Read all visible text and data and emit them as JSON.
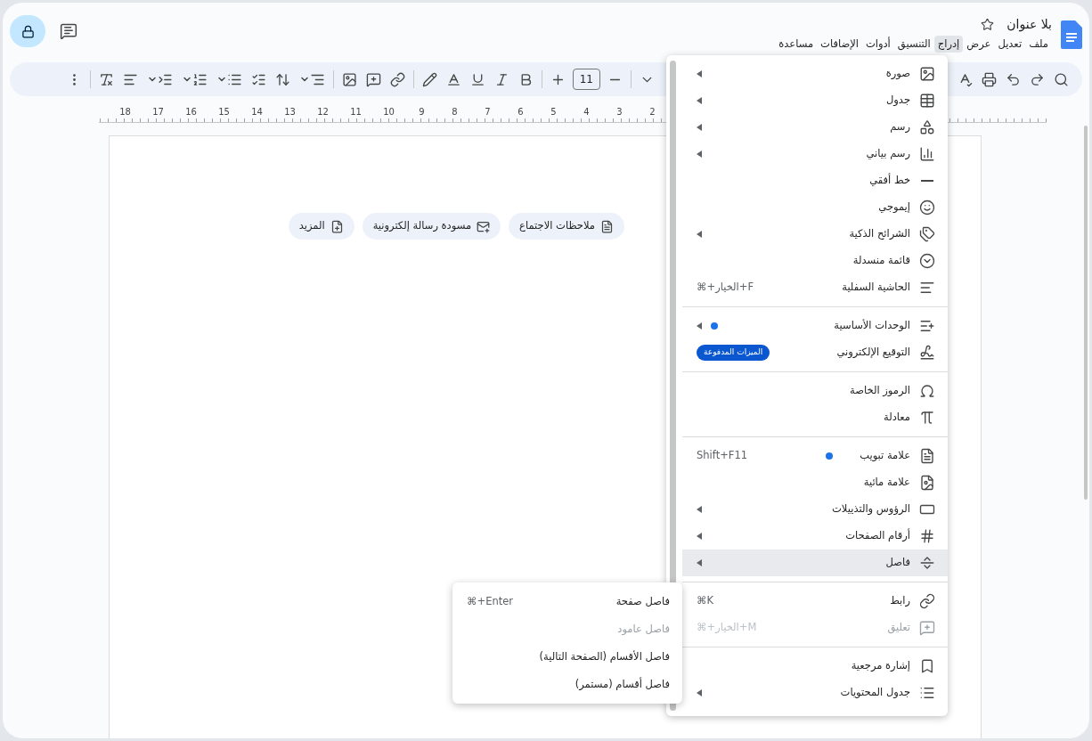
{
  "document": {
    "title": "بلا عنوان",
    "starred": false
  },
  "menubar": [
    {
      "label": "ملف",
      "selected": false
    },
    {
      "label": "تعديل",
      "selected": false
    },
    {
      "label": "عرض",
      "selected": false
    },
    {
      "label": "إدراج",
      "selected": true
    },
    {
      "label": "التنسيق",
      "selected": false
    },
    {
      "label": "أدوات",
      "selected": false
    },
    {
      "label": "الإضافات",
      "selected": false
    },
    {
      "label": "مساعدة",
      "selected": false
    }
  ],
  "toolbar": {
    "font_size": "11"
  },
  "ruler": {
    "numbers": [
      "2",
      "3",
      "4",
      "5",
      "6",
      "7",
      "8",
      "9",
      "10",
      "11",
      "12",
      "13",
      "14",
      "15",
      "16",
      "17",
      "18"
    ]
  },
  "chips": [
    "ملاحظات الاجتماع",
    "مسودة رسالة إلكترونية",
    "المزيد"
  ],
  "insert_menu": [
    [
      {
        "label": "صورة",
        "submenu": true,
        "new": false,
        "disabled": false,
        "selected": false
      },
      {
        "label": "جدول",
        "submenu": true,
        "new": false,
        "disabled": false,
        "selected": false
      },
      {
        "label": "رسم",
        "submenu": true,
        "new": false,
        "disabled": false,
        "selected": false
      },
      {
        "label": "رسم بياني",
        "submenu": true,
        "new": false,
        "disabled": false,
        "selected": false
      },
      {
        "label": "خط أفقي",
        "submenu": false,
        "new": false,
        "disabled": false,
        "selected": false
      },
      {
        "label": "إيموجي",
        "submenu": false,
        "new": false,
        "disabled": false,
        "selected": false
      },
      {
        "label": "الشرائح الذكية",
        "submenu": true,
        "new": false,
        "disabled": false,
        "selected": false
      },
      {
        "label": "قائمة منسدلة",
        "submenu": false,
        "new": false,
        "disabled": false,
        "selected": false
      },
      {
        "label": "الحاشية السفلية",
        "submenu": false,
        "new": false,
        "disabled": false,
        "selected": false,
        "shortcut": "⌘+الخيار+F"
      }
    ],
    [
      {
        "label": "الوحدات الأساسية",
        "submenu": true,
        "new": true,
        "disabled": false,
        "selected": false
      },
      {
        "label": "التوقيع الإلكتروني",
        "submenu": false,
        "new": false,
        "disabled": false,
        "selected": false,
        "badge": "الميزات المدفوعة"
      }
    ],
    [
      {
        "label": "الرموز الخاصة",
        "submenu": false,
        "new": false,
        "disabled": false,
        "selected": false
      },
      {
        "label": "معادلة",
        "submenu": false,
        "new": false,
        "disabled": false,
        "selected": false
      }
    ],
    [
      {
        "label": "علامة تبويب",
        "submenu": false,
        "new": true,
        "disabled": false,
        "selected": false,
        "shortcut": "Shift+F11"
      },
      {
        "label": "علامة مائية",
        "submenu": false,
        "new": false,
        "disabled": false,
        "selected": false
      },
      {
        "label": "الرؤوس والتذييلات",
        "submenu": true,
        "new": false,
        "disabled": false,
        "selected": false
      },
      {
        "label": "أرقام الصفحات",
        "submenu": true,
        "new": false,
        "disabled": false,
        "selected": false
      },
      {
        "label": "فاصل",
        "submenu": true,
        "new": false,
        "disabled": false,
        "selected": true
      }
    ],
    [
      {
        "label": "رابط",
        "submenu": false,
        "new": false,
        "disabled": false,
        "selected": false,
        "shortcut": "⌘K"
      },
      {
        "label": "تعليق",
        "submenu": false,
        "new": false,
        "disabled": true,
        "selected": false,
        "shortcut": "⌘+الخيار+M"
      }
    ],
    [
      {
        "label": "إشارة مرجعية",
        "submenu": false,
        "new": false,
        "disabled": false,
        "selected": false
      },
      {
        "label": "جدول المحتويات",
        "submenu": true,
        "new": false,
        "disabled": false,
        "selected": false
      }
    ]
  ],
  "break_submenu": [
    {
      "label": "فاصل صفحة",
      "disabled": false,
      "shortcut": "⌘+Enter"
    },
    {
      "label": "فاصل عامود",
      "disabled": true
    },
    {
      "label": "فاصل الأقسام (الصفحة التالية)",
      "disabled": false
    },
    {
      "label": "فاصل أقسام (مستمر)",
      "disabled": false
    }
  ]
}
